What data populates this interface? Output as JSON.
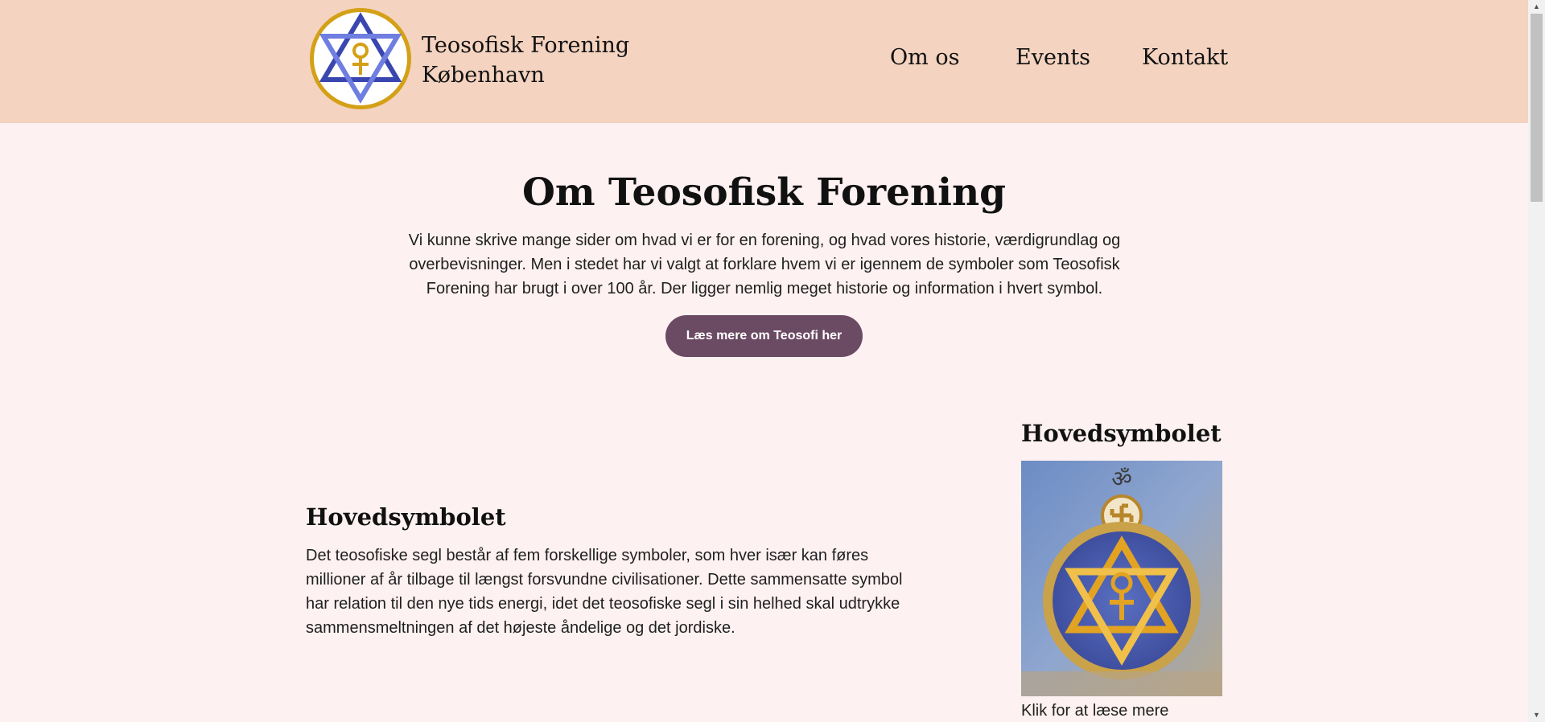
{
  "header": {
    "site_title_line1": "Teosofisk Forening",
    "site_title_line2": "København",
    "logo_icon": "teosofisk-star-ankh-logo",
    "nav": {
      "om_os": "Om os",
      "events": "Events",
      "kontakt": "Kontakt"
    }
  },
  "intro": {
    "heading": "Om Teosofisk Forening",
    "text": "Vi kunne skrive mange sider om hvad vi er for en forening, og hvad vores historie, værdigrundlag og overbevisninger. Men i stedet har vi valgt at forklare hvem vi er igennem de symboler som Teosofisk Forening har brugt i over 100 år. Der ligger nemlig meget historie og information i hvert symbol.",
    "button_label": "Læs mere om Teosofi her"
  },
  "main_symbol": {
    "heading": "Hovedsymbolet",
    "text": "Det teosofiske segl består af fem forskellige symboler, som hver især kan føres millioner af år tilbage til længst forsvundne civilisationer. Dette sammensatte symbol har relation til den nye tids energi, idet det teosofiske segl i sin helhed skal udtrykke sammensmeltningen af det højeste åndelige og det jordiske."
  },
  "sidebar": {
    "heading": "Hovedsymbolet",
    "image_icon": "theosophical-seal-image",
    "om_glyph": "ॐ",
    "caption": "Klik for at læse mere"
  },
  "colors": {
    "header_bg": "#F4D3C0",
    "page_bg": "#FDF1F1",
    "button_bg": "#6B4A63",
    "logo_ring": "#D4A017",
    "logo_star": "#4A5BC4"
  }
}
